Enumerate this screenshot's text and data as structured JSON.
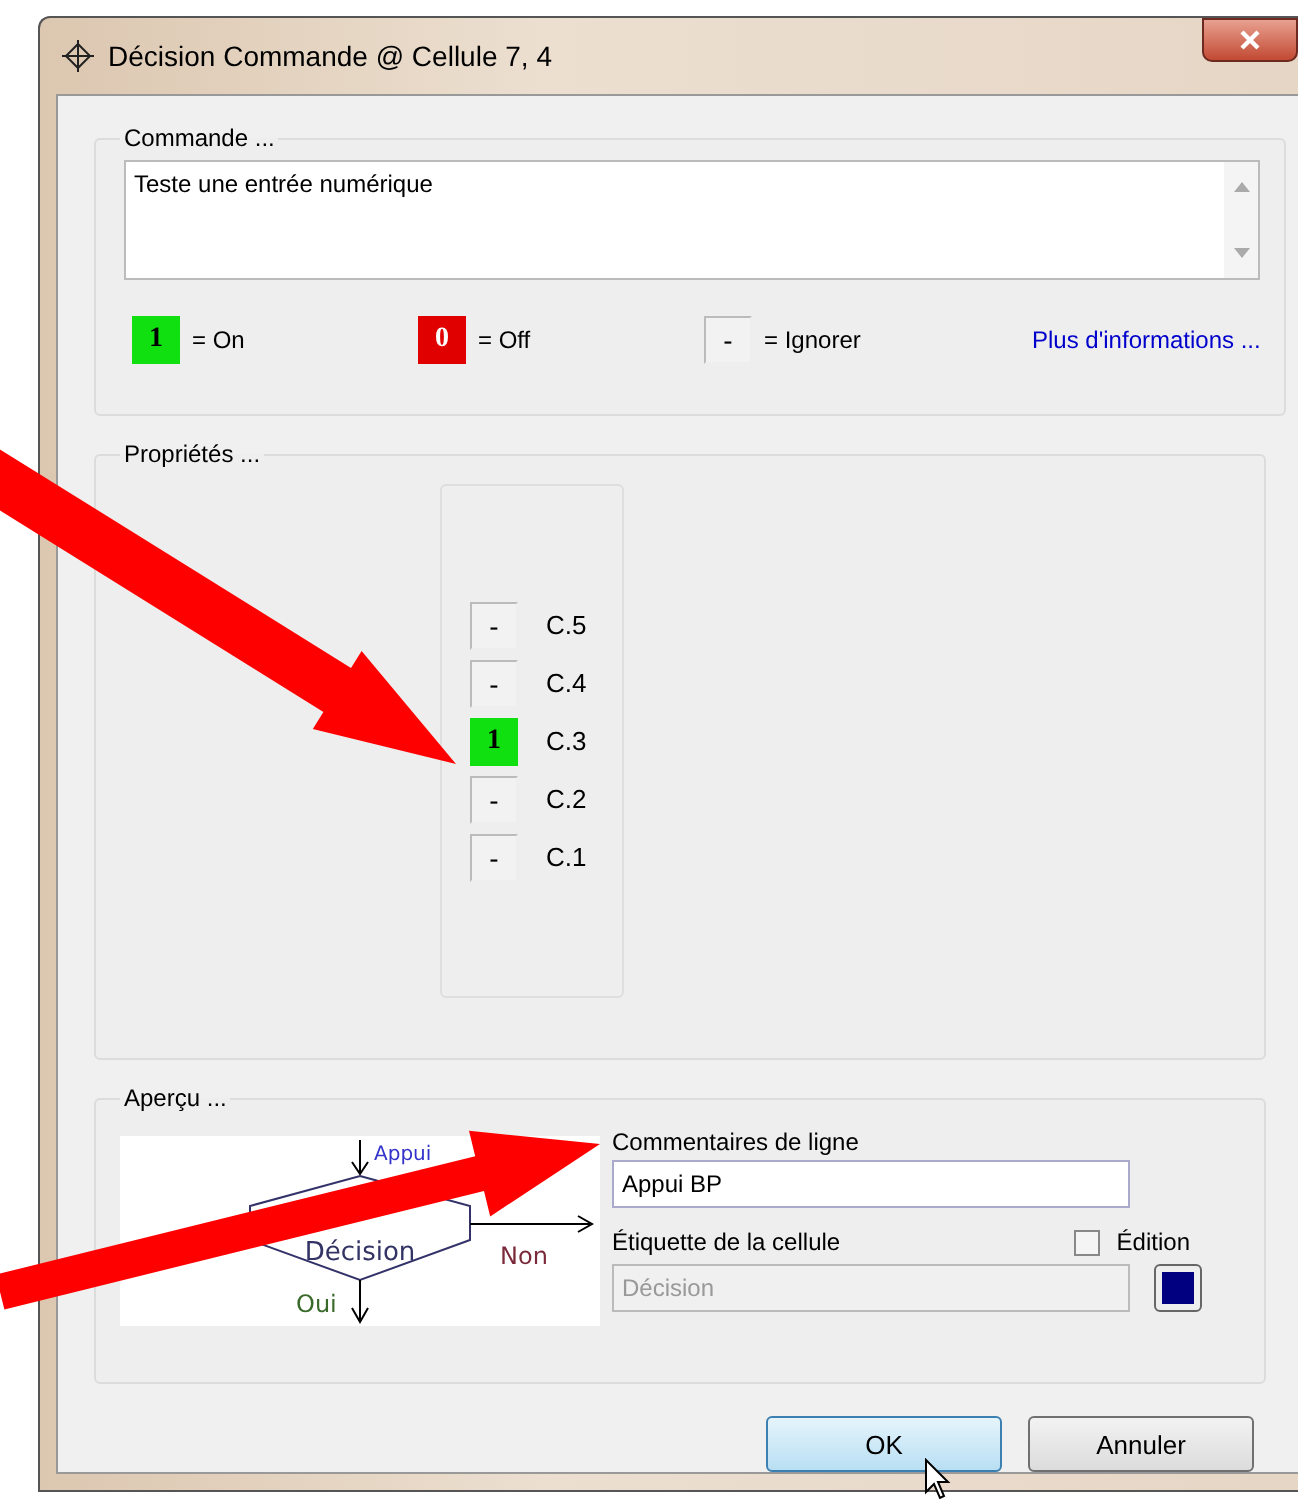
{
  "window": {
    "title": "Décision Commande @ Cellule 7, 4"
  },
  "commande": {
    "label": "Commande ...",
    "text": "Teste une entrée numérique",
    "legend": [
      {
        "kind": "on",
        "symbol": "1",
        "text": "= On"
      },
      {
        "kind": "off",
        "symbol": "0",
        "text": "= Off"
      },
      {
        "kind": "ignore",
        "symbol": "-",
        "text": "= Ignorer"
      }
    ],
    "info_link": "Plus d'informations ..."
  },
  "proprietes": {
    "label": "Propriétés ...",
    "inputs": [
      {
        "kind": "ignore",
        "symbol": "-",
        "label": "C.5"
      },
      {
        "kind": "ignore",
        "symbol": "-",
        "label": "C.4"
      },
      {
        "kind": "on",
        "symbol": "1",
        "label": "C.3"
      },
      {
        "kind": "ignore",
        "symbol": "-",
        "label": "C.2"
      },
      {
        "kind": "ignore",
        "symbol": "-",
        "label": "C.1"
      }
    ]
  },
  "apercu": {
    "label": "Aperçu ...",
    "diagram": {
      "comment": "Appui",
      "label": "Décision",
      "no": "Non",
      "yes": "Oui"
    },
    "comment_label": "Commentaires de ligne",
    "comment_value": "Appui BP",
    "cell_label": "Étiquette de la cellule",
    "edition": {
      "label": "Édition",
      "checked": false
    },
    "cell_value": "Décision",
    "cell_disabled": true,
    "color": "#000080"
  },
  "buttons": [
    {
      "label": "OK",
      "default": true
    },
    {
      "label": "Annuler",
      "default": false
    }
  ]
}
